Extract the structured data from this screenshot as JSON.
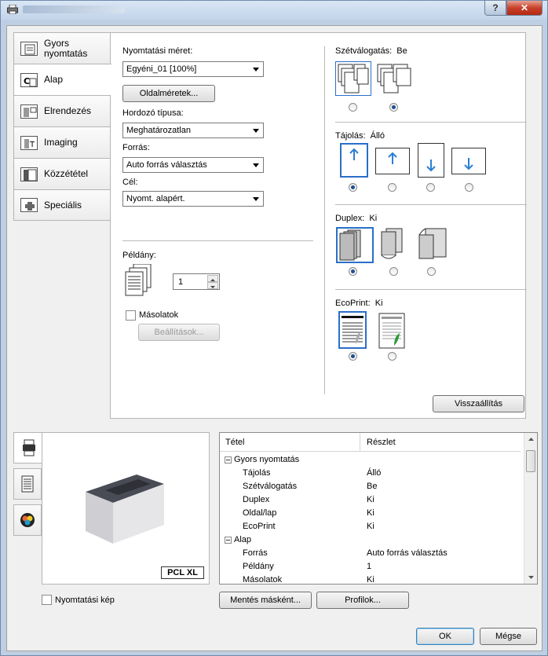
{
  "titlebar": {
    "help": "?",
    "close": "✕"
  },
  "nav": [
    {
      "label": "Gyors nyomtatás",
      "icon": "quick-print-icon"
    },
    {
      "label": "Alap",
      "icon": "basic-icon"
    },
    {
      "label": "Elrendezés",
      "icon": "layout-icon"
    },
    {
      "label": "Imaging",
      "icon": "imaging-icon"
    },
    {
      "label": "Közzététel",
      "icon": "publishing-icon"
    },
    {
      "label": "Speciális",
      "icon": "advanced-icon"
    }
  ],
  "basic": {
    "print_size_label": "Nyomtatási méret:",
    "print_size_value": "Egyéni_01 [100%]",
    "page_sizes_button": "Oldalméretek...",
    "media_type_label": "Hordozó típusa:",
    "media_type_value": "Meghatározatlan",
    "source_label": "Forrás:",
    "source_value": "Auto forrás választás",
    "destination_label": "Cél:",
    "destination_value": "Nyomt. alapért.",
    "copies_label": "Példány:",
    "copies_value": "1",
    "copies_checkbox_label": "Másolatok",
    "settings_button": "Beállítások...",
    "collate_label": "Szétválogatás:",
    "collate_value": "Be",
    "orientation_label": "Tájolás:",
    "orientation_value": "Álló",
    "duplex_label": "Duplex:",
    "duplex_value": "Ki",
    "ecoprint_label": "EcoPrint:",
    "ecoprint_value": "Ki",
    "reset_button": "Visszaállítás"
  },
  "preview": {
    "pcl_badge": "PCL XL",
    "print_image_label": "Nyomtatási kép"
  },
  "grid": {
    "col_item": "Tétel",
    "col_detail": "Részlet",
    "rows": [
      {
        "k": "Gyors nyomtatás",
        "v": "",
        "group": true
      },
      {
        "k": "Tájolás",
        "v": "Álló"
      },
      {
        "k": "Szétválogatás",
        "v": "Be"
      },
      {
        "k": "Duplex",
        "v": "Ki"
      },
      {
        "k": "Oldal/lap",
        "v": "Ki"
      },
      {
        "k": "EcoPrint",
        "v": "Ki"
      },
      {
        "k": "Alap",
        "v": "",
        "group": true
      },
      {
        "k": "Forrás",
        "v": "Auto forrás választás"
      },
      {
        "k": "Példány",
        "v": "1"
      },
      {
        "k": "Másolatok",
        "v": "Ki"
      }
    ]
  },
  "footer": {
    "save_as_button": "Mentés másként...",
    "profiles_button": "Profilok...",
    "ok_button": "OK",
    "cancel_button": "Mégse"
  }
}
